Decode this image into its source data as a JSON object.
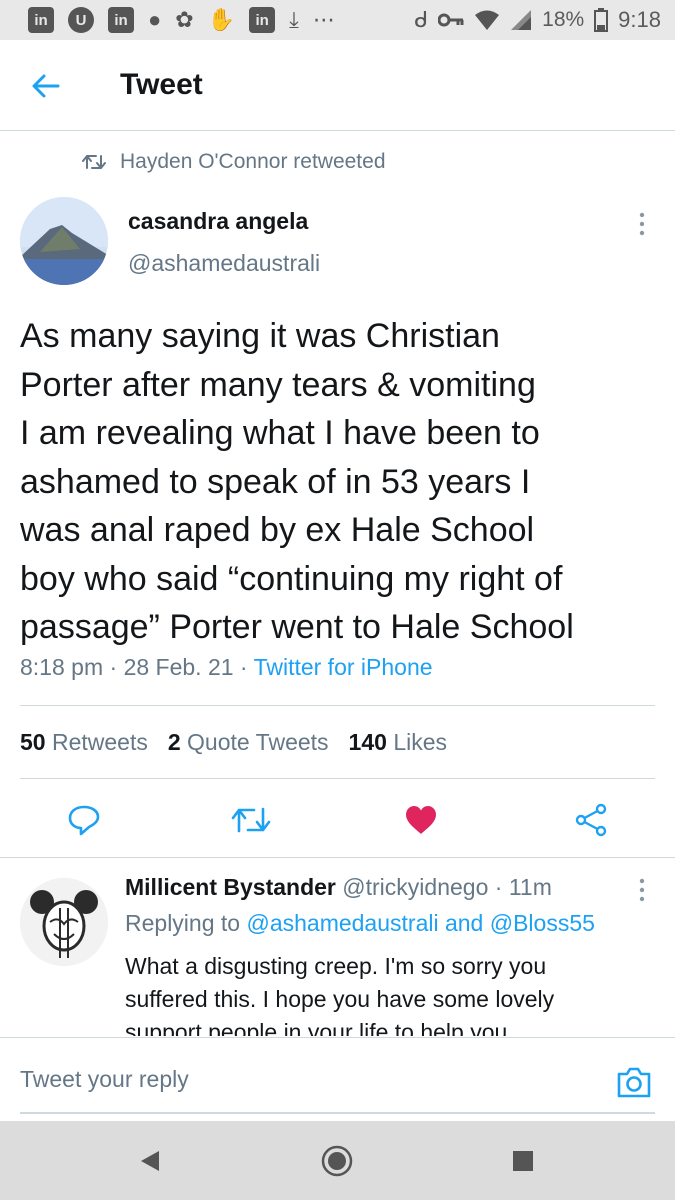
{
  "status_bar": {
    "app_icons": [
      "in",
      "U",
      "in"
    ],
    "battery_percent": "18%",
    "time": "9:18"
  },
  "header": {
    "title": "Tweet"
  },
  "retweet": {
    "text": "Hayden O'Connor retweeted"
  },
  "tweet": {
    "author_name": "casandra angela",
    "author_handle": "@ashamedaustrali",
    "text_lines": [
      "As many saying it was Christian",
      "Porter after many tears & vomiting",
      "I am revealing what I have been to",
      "ashamed to speak of in 53 years I",
      "was anal raped by ex Hale School",
      "boy who said “continuing my right of",
      "passage” Porter went to Hale School"
    ],
    "time": "8:18 pm",
    "date": "28 Feb. 21",
    "source": "Twitter for iPhone",
    "stats": {
      "retweets_count": "50",
      "retweets_label": "Retweets",
      "quotes_count": "2",
      "quotes_label": "Quote Tweets",
      "likes_count": "140",
      "likes_label": "Likes"
    },
    "liked": true
  },
  "reply": {
    "name": "Millicent Bystander",
    "handle": "@trickyidnego",
    "time": "11m",
    "replying_prefix": "Replying to",
    "mention_1": "@ashamedaustrali",
    "and_text": "and",
    "mention_2": "@Bloss55",
    "text_lines": [
      "What a disgusting creep. I'm so sorry you",
      "suffered this. I hope you have some lovely",
      "support people in your life to help you"
    ]
  },
  "compose": {
    "placeholder": "Tweet your reply"
  },
  "colors": {
    "accent": "#1da1f2",
    "like": "#e0245e",
    "secondary_text": "#657786",
    "divider": "#cfd9de"
  }
}
